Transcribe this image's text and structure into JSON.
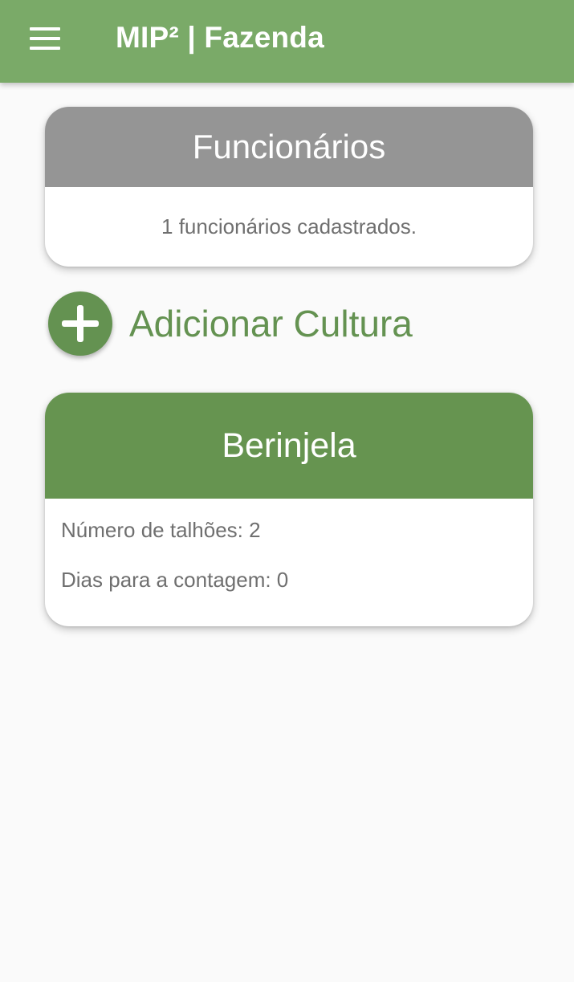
{
  "app_bar": {
    "menu_icon": "menu-icon",
    "title": "MIP² | Fazenda",
    "color": "#7aaa68"
  },
  "employees_card": {
    "title": "Funcionários",
    "summary": "1 funcionários cadastrados.",
    "header_color": "#959595"
  },
  "add_crop": {
    "icon": "plus-circle-icon",
    "label": "Adicionar Cultura",
    "color": "#649251"
  },
  "crops": [
    {
      "name": "Berinjela",
      "plots_text": "Número de talhões: 2",
      "days_text": "Dias para a contagem: 0",
      "header_color": "#669450"
    }
  ]
}
